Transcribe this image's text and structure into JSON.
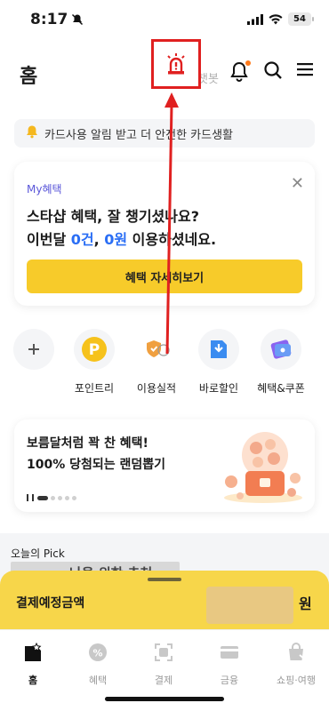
{
  "status_bar": {
    "time": "8:17",
    "battery": "54"
  },
  "header": {
    "title": "홈",
    "bot_text": "챗봇"
  },
  "notice": {
    "text": "카드사용 알림 받고 더 안전한 카드생활"
  },
  "benefit_card": {
    "tag": "My혜택",
    "line1": "스타샵 혜택, 잘 챙기셨나요?",
    "line2_prefix": "이번달 ",
    "count": "0건",
    "sep": ", ",
    "amount": "0원",
    "line2_suffix": " 이용하셨네요.",
    "button": "혜택 자세히보기"
  },
  "shortcuts": [
    {
      "label": "",
      "icon": "plus-icon"
    },
    {
      "label": "포인트리",
      "icon": "point-icon"
    },
    {
      "label": "이용실적",
      "icon": "usage-shield-icon"
    },
    {
      "label": "바로할인",
      "icon": "discount-icon"
    },
    {
      "label": "혜택&쿠폰",
      "icon": "coupon-icon"
    }
  ],
  "promo": {
    "line1": "보름달처럼 꽉 찬 혜택!",
    "line2": "100% 당첨되는 랜덤뽑기"
  },
  "pick": {
    "title": "오늘의 Pick",
    "subtitle": "나을 위한 추천"
  },
  "payment": {
    "label": "결제예정금액",
    "unit": "원"
  },
  "tabs": [
    {
      "label": "홈",
      "icon": "home-star-icon",
      "active": true
    },
    {
      "label": "혜택",
      "icon": "benefit-badge-icon",
      "active": false
    },
    {
      "label": "결제",
      "icon": "scan-pay-icon",
      "active": false
    },
    {
      "label": "금융",
      "icon": "card-icon",
      "active": false
    },
    {
      "label": "쇼핑·여행",
      "icon": "shopping-bag-icon",
      "active": false
    }
  ],
  "colors": {
    "accent_yellow": "#f7cb2a",
    "link_blue": "#2a6ef5",
    "annotation_red": "#e02020"
  }
}
